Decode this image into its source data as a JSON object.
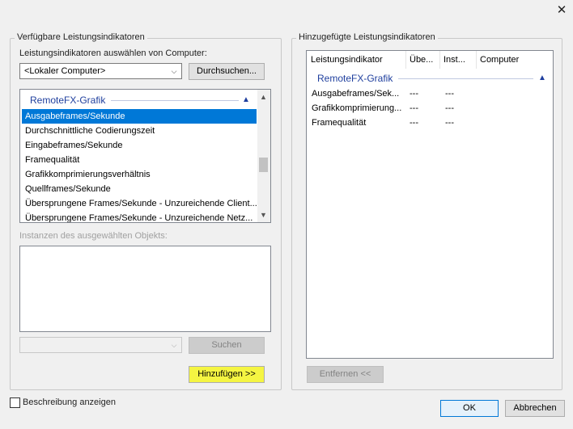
{
  "window": {
    "close_glyph": "✕"
  },
  "left_group": {
    "title": "Verfügbare Leistungsindikatoren",
    "computer_label": "Leistungsindikatoren auswählen von Computer:",
    "computer_value": "<Lokaler Computer>",
    "browse_button": "Durchsuchen...",
    "counter_list": {
      "category": "RemoteFX-Grafik",
      "items": [
        {
          "label": "Ausgabeframes/Sekunde",
          "selected": true
        },
        {
          "label": "Durchschnittliche Codierungszeit",
          "selected": false
        },
        {
          "label": "Eingabeframes/Sekunde",
          "selected": false
        },
        {
          "label": "Framequalität",
          "selected": false
        },
        {
          "label": "Grafikkomprimierungsverhältnis",
          "selected": false
        },
        {
          "label": "Quellframes/Sekunde",
          "selected": false
        },
        {
          "label": "Übersprungene Frames/Sekunde - Unzureichende Client...",
          "selected": false
        },
        {
          "label": "Übersprungene Frames/Sekunde - Unzureichende Netz...",
          "selected": false
        }
      ]
    },
    "instances_label": "Instanzen des ausgewählten Objekts:",
    "search_value": "",
    "search_button": "Suchen",
    "add_button": "Hinzufügen >>"
  },
  "right_group": {
    "title": "Hinzugefügte Leistungsindikatoren",
    "columns": [
      "Leistungsindikator",
      "Übe...",
      "Inst...",
      "Computer"
    ],
    "category": "RemoteFX-Grafik",
    "rows": [
      {
        "counter": "Ausgabeframes/Sek...",
        "parent": "---",
        "instance": "---",
        "computer": ""
      },
      {
        "counter": "Grafikkomprimierung...",
        "parent": "---",
        "instance": "---",
        "computer": ""
      },
      {
        "counter": "Framequalität",
        "parent": "---",
        "instance": "---",
        "computer": ""
      }
    ],
    "remove_button": "Entfernen <<"
  },
  "footer": {
    "show_description": "Beschreibung anzeigen",
    "show_description_checked": false,
    "ok_button": "OK",
    "cancel_button": "Abbrechen"
  },
  "colors": {
    "selection": "#0078d7",
    "category": "#1f3f9e",
    "highlight": "#f5f542"
  }
}
